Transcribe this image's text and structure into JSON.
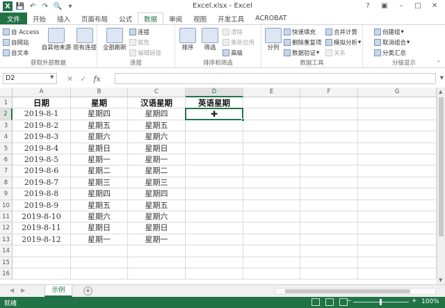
{
  "app": {
    "title": "Excel.xlsx - Excel",
    "help": "?",
    "win_min": "–",
    "win_max": "□",
    "win_close": "✕"
  },
  "tabs": [
    "文件",
    "开始",
    "插入",
    "页面布局",
    "公式",
    "数据",
    "审阅",
    "视图",
    "开发工具",
    "ACROBAT"
  ],
  "active_tab": "数据",
  "ribbon": {
    "get_external": {
      "label": "获取外部数据",
      "access": "自 Access",
      "web": "自网站",
      "text": "自文本",
      "other": "自其他来源",
      "existing": "现有连接"
    },
    "connections": {
      "label": "连接",
      "refresh_all": "全部刷新",
      "connections": "连接",
      "properties": "属性",
      "edit_links": "编辑链接"
    },
    "sort_filter": {
      "label": "排序和筛选",
      "sort": "排序",
      "filter": "筛选",
      "clear": "清除",
      "reapply": "重新应用",
      "advanced": "高级"
    },
    "data_tools": {
      "label": "数据工具",
      "split": "分列",
      "flash_fill": "快速填充",
      "remove_dup": "删除重复项",
      "validation": "数据验证",
      "consolidate": "合并计算",
      "what_if": "模拟分析",
      "relationships": "关系"
    },
    "outline": {
      "label": "分级显示",
      "group": "创建组",
      "ungroup": "取消组合",
      "subtotal": "分类汇总"
    }
  },
  "formula_bar": {
    "name_box": "D2",
    "cancel": "✕",
    "enter": "✓",
    "fx": "fx",
    "formula": ""
  },
  "sheet": {
    "columns": [
      "A",
      "B",
      "C",
      "D",
      "E",
      "F",
      "G"
    ],
    "rows": [
      "1",
      "2",
      "3",
      "4",
      "5",
      "6",
      "7",
      "8",
      "9",
      "10",
      "11",
      "12",
      "13",
      "14",
      "15",
      "16"
    ],
    "headers": [
      "日期",
      "星期",
      "汉语星期",
      "英语星期"
    ],
    "data": [
      [
        "2019-8-1",
        "星期四",
        "星期四"
      ],
      [
        "2019-8-2",
        "星期五",
        "星期五"
      ],
      [
        "2019-8-3",
        "星期六",
        "星期六"
      ],
      [
        "2019-8-4",
        "星期日",
        "星期日"
      ],
      [
        "2019-8-5",
        "星期一",
        "星期一"
      ],
      [
        "2019-8-6",
        "星期二",
        "星期二"
      ],
      [
        "2019-8-7",
        "星期三",
        "星期三"
      ],
      [
        "2019-8-8",
        "星期四",
        "星期四"
      ],
      [
        "2019-8-9",
        "星期五",
        "星期五"
      ],
      [
        "2019-8-10",
        "星期六",
        "星期六"
      ],
      [
        "2019-8-11",
        "星期日",
        "星期日"
      ],
      [
        "2019-8-12",
        "星期一",
        "星期一"
      ]
    ],
    "active_cell": "D2"
  },
  "sheet_tabs": {
    "active": "示例",
    "add": "+",
    "prev": "◀",
    "next": "▶"
  },
  "status": {
    "text": "就绪",
    "zoom": "100%",
    "zoom_minus": "−",
    "zoom_plus": "+"
  },
  "colors": {
    "accent": "#217346"
  }
}
